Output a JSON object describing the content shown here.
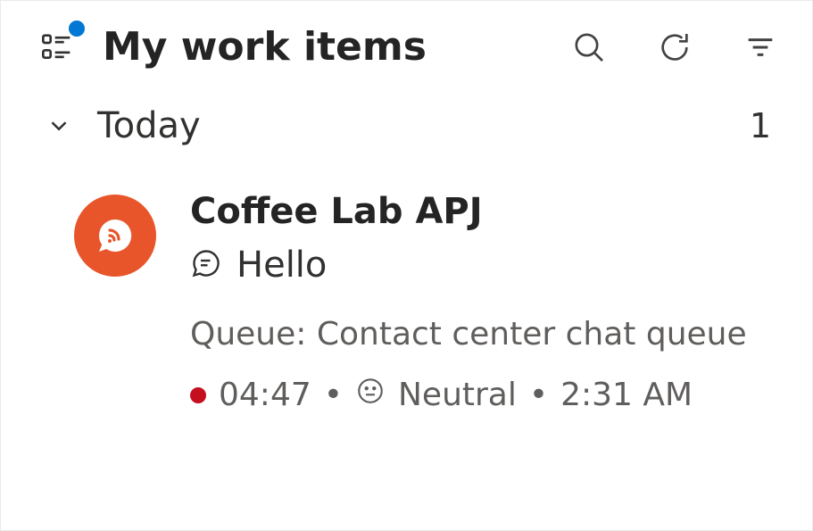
{
  "header": {
    "title": "My work items"
  },
  "section": {
    "title": "Today",
    "count": "1"
  },
  "item": {
    "title": "Coffee Lab APJ",
    "preview": "Hello",
    "queue_label": "Queue:",
    "queue_name": "Contact center chat queue",
    "duration": "04:47",
    "sentiment": "Neutral",
    "time": "2:31 AM",
    "status_color": "#c50f1f",
    "avatar_color": "#E8552B"
  },
  "icons": {
    "toggle": "list-detail-toggle",
    "search": "search",
    "refresh": "refresh",
    "filter": "filter",
    "chevron": "chevron-down",
    "chat": "chat-bubble",
    "face": "neutral-face"
  }
}
